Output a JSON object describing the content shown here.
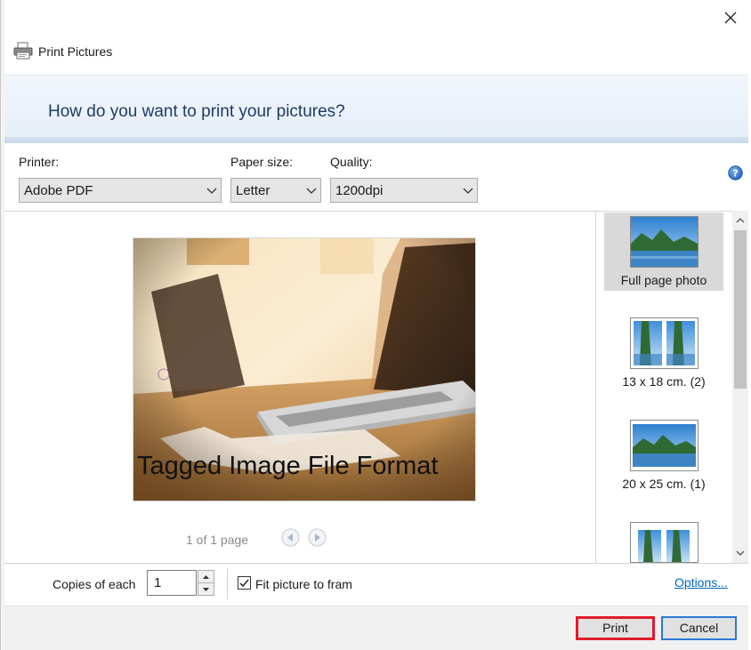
{
  "window": {
    "title": "Print Pictures",
    "close_icon": "close-icon",
    "app_icon": "printer-icon"
  },
  "banner": {
    "heading": "How do you want to print your pictures?"
  },
  "settings": {
    "printer": {
      "label": "Printer:",
      "value": "Adobe PDF"
    },
    "paper_size": {
      "label": "Paper size:",
      "value": "Letter"
    },
    "quality": {
      "label": "Quality:",
      "value": "1200dpi"
    },
    "help_icon": "help-icon"
  },
  "preview": {
    "caption": "Tagged Image File Format",
    "page_indicator": "1 of 1 page",
    "prev_icon": "arrow-left-icon",
    "next_icon": "arrow-right-icon"
  },
  "layouts": [
    {
      "label": "Full page photo",
      "selected": true
    },
    {
      "label": "13 x 18 cm. (2)",
      "selected": false
    },
    {
      "label": "20 x 25 cm. (1)",
      "selected": false
    },
    {
      "label": "",
      "selected": false
    }
  ],
  "options": {
    "copies_label": "Copies of each",
    "copies_value": "1",
    "fit_label": "Fit picture to fram",
    "fit_checked": true,
    "options_link": "Options..."
  },
  "footer": {
    "print_label": "Print",
    "cancel_label": "Cancel"
  },
  "colors": {
    "accent_blue": "#2b79d4",
    "highlight_red": "#e01c2c",
    "link_blue": "#0066cc",
    "banner_text": "#1e3c64"
  }
}
